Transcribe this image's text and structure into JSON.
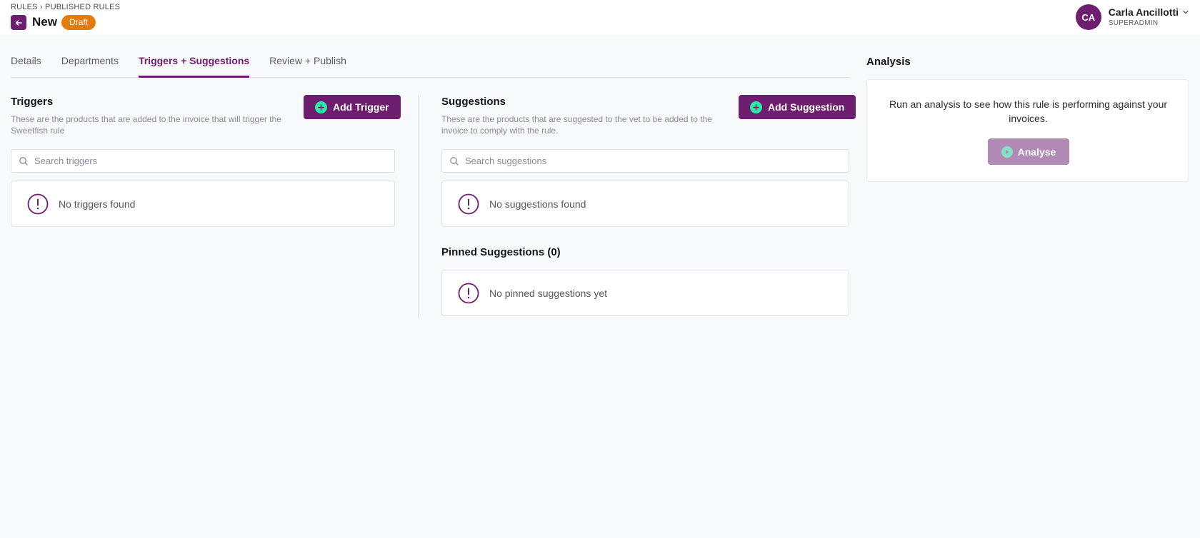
{
  "header": {
    "breadcrumb": "RULES › PUBLISHED RULES",
    "title": "New",
    "status_badge": "Draft",
    "user": {
      "initials": "CA",
      "name": "Carla Ancillotti",
      "role": "SUPERADMIN"
    }
  },
  "tabs": [
    {
      "label": "Details",
      "active": false
    },
    {
      "label": "Departments",
      "active": false
    },
    {
      "label": "Triggers + Suggestions",
      "active": true
    },
    {
      "label": "Review + Publish",
      "active": false
    }
  ],
  "triggers": {
    "title": "Triggers",
    "description": "These are the products that are added to the invoice that will trigger the Sweetfish rule",
    "add_label": "Add Trigger",
    "search_placeholder": "Search triggers",
    "empty_text": "No triggers found"
  },
  "suggestions": {
    "title": "Suggestions",
    "description": "These are the products that are suggested to the vet to be added to the invoice to comply with the rule.",
    "add_label": "Add Suggestion",
    "search_placeholder": "Search suggestions",
    "empty_text": "No suggestions found"
  },
  "pinned": {
    "title": "Pinned Suggestions (0)",
    "empty_text": "No pinned suggestions yet"
  },
  "analysis": {
    "title": "Analysis",
    "text": "Run an analysis to see how this rule is performing against your invoices.",
    "button_label": "Analyse"
  },
  "colors": {
    "brand": "#6e1e6e",
    "accent": "#2ee8a8",
    "draft": "#e47c0c"
  },
  "icons": [
    "back-arrow-icon",
    "chevron-down-icon",
    "plus-circle-icon",
    "search-icon",
    "alert-circle-icon",
    "play-circle-icon"
  ]
}
